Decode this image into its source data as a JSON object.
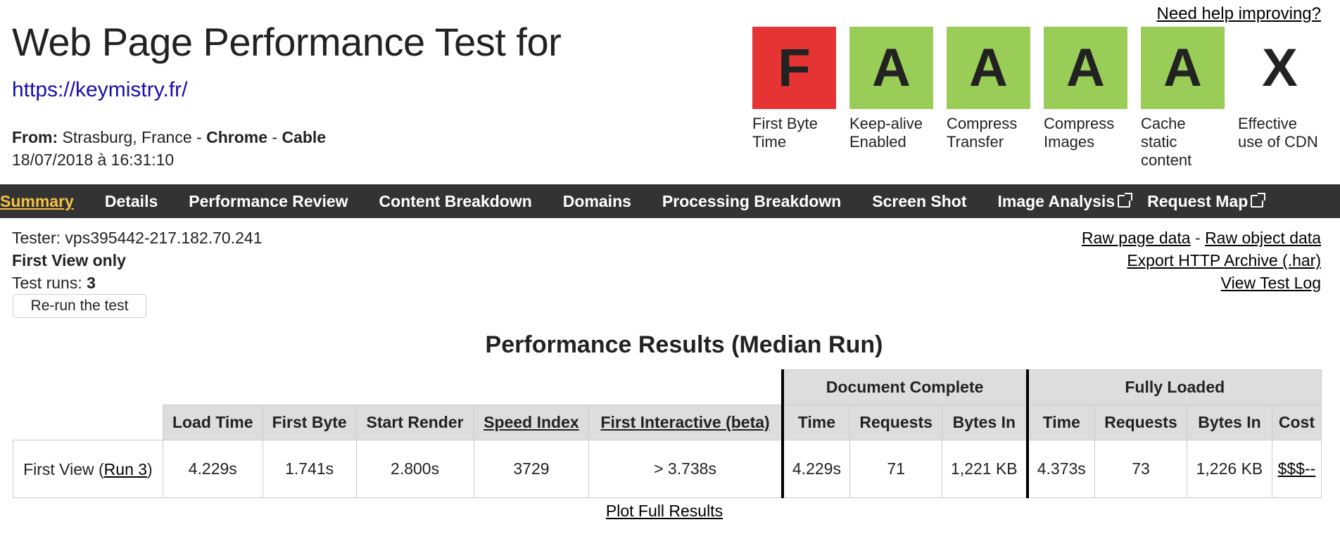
{
  "header": {
    "title": "Web Page Performance Test for",
    "url": "https://keymistry.fr/",
    "from_label": "From:",
    "location": " Strasburg, France - ",
    "browser": "Chrome",
    "sep": " - ",
    "connection": "Cable",
    "date": "18/07/2018 à 16:31:10",
    "help_link": "Need help improving?"
  },
  "grades": [
    {
      "letter": "F",
      "label": "First Byte Time",
      "status": "red"
    },
    {
      "letter": "A",
      "label": "Keep-alive Enabled",
      "status": "green"
    },
    {
      "letter": "A",
      "label": "Compress Transfer",
      "status": "green"
    },
    {
      "letter": "A",
      "label": "Compress Images",
      "status": "green"
    },
    {
      "letter": "A",
      "label": "Cache static content",
      "status": "green"
    },
    {
      "letter": "X",
      "label": "Effective use of CDN",
      "status": "none"
    }
  ],
  "colors": {
    "fail": "#e63434",
    "pass": "#9acd57",
    "nav_bg": "#333333",
    "nav_active": "#f5c142"
  },
  "nav": [
    {
      "label": "Summary",
      "active": true
    },
    {
      "label": "Details"
    },
    {
      "label": "Performance Review"
    },
    {
      "label": "Content Breakdown"
    },
    {
      "label": "Domains"
    },
    {
      "label": "Processing Breakdown"
    },
    {
      "label": "Screen Shot"
    },
    {
      "label": "Image Analysis",
      "icon": "external-link-icon"
    },
    {
      "label": "Request Map",
      "icon": "external-link-icon"
    }
  ],
  "info": {
    "tester": "Tester: vps395442-217.182.70.241",
    "view": "First View only",
    "runs_label": "Test runs: ",
    "runs_value": "3",
    "rerun_label": "Re-run the test"
  },
  "links": {
    "raw_page": "Raw page data",
    "dash": " - ",
    "raw_object": "Raw object data",
    "export_har": "Export HTTP Archive (.har)",
    "test_log": "View Test Log"
  },
  "results": {
    "title": "Performance Results (Median Run)",
    "group_headers": {
      "doc_complete": "Document Complete",
      "fully_loaded": "Fully Loaded"
    },
    "columns": {
      "load_time": "Load Time",
      "first_byte": "First Byte",
      "start_render": "Start Render",
      "speed_index": "Speed Index",
      "first_interactive": "First Interactive (beta)",
      "dc_time": "Time",
      "dc_requests": "Requests",
      "dc_bytes": "Bytes In",
      "fl_time": "Time",
      "fl_requests": "Requests",
      "fl_bytes": "Bytes In",
      "cost": "Cost"
    },
    "row": {
      "label_prefix": "First View (",
      "run_link": "Run 3",
      "label_suffix": ")",
      "load_time": "4.229s",
      "first_byte": "1.741s",
      "start_render": "2.800s",
      "speed_index": "3729",
      "first_interactive": "> 3.738s",
      "dc_time": "4.229s",
      "dc_requests": "71",
      "dc_bytes": "1,221 KB",
      "fl_time": "4.373s",
      "fl_requests": "73",
      "fl_bytes": "1,226 KB",
      "cost": "$$$--"
    },
    "plot_link": "Plot Full Results"
  }
}
